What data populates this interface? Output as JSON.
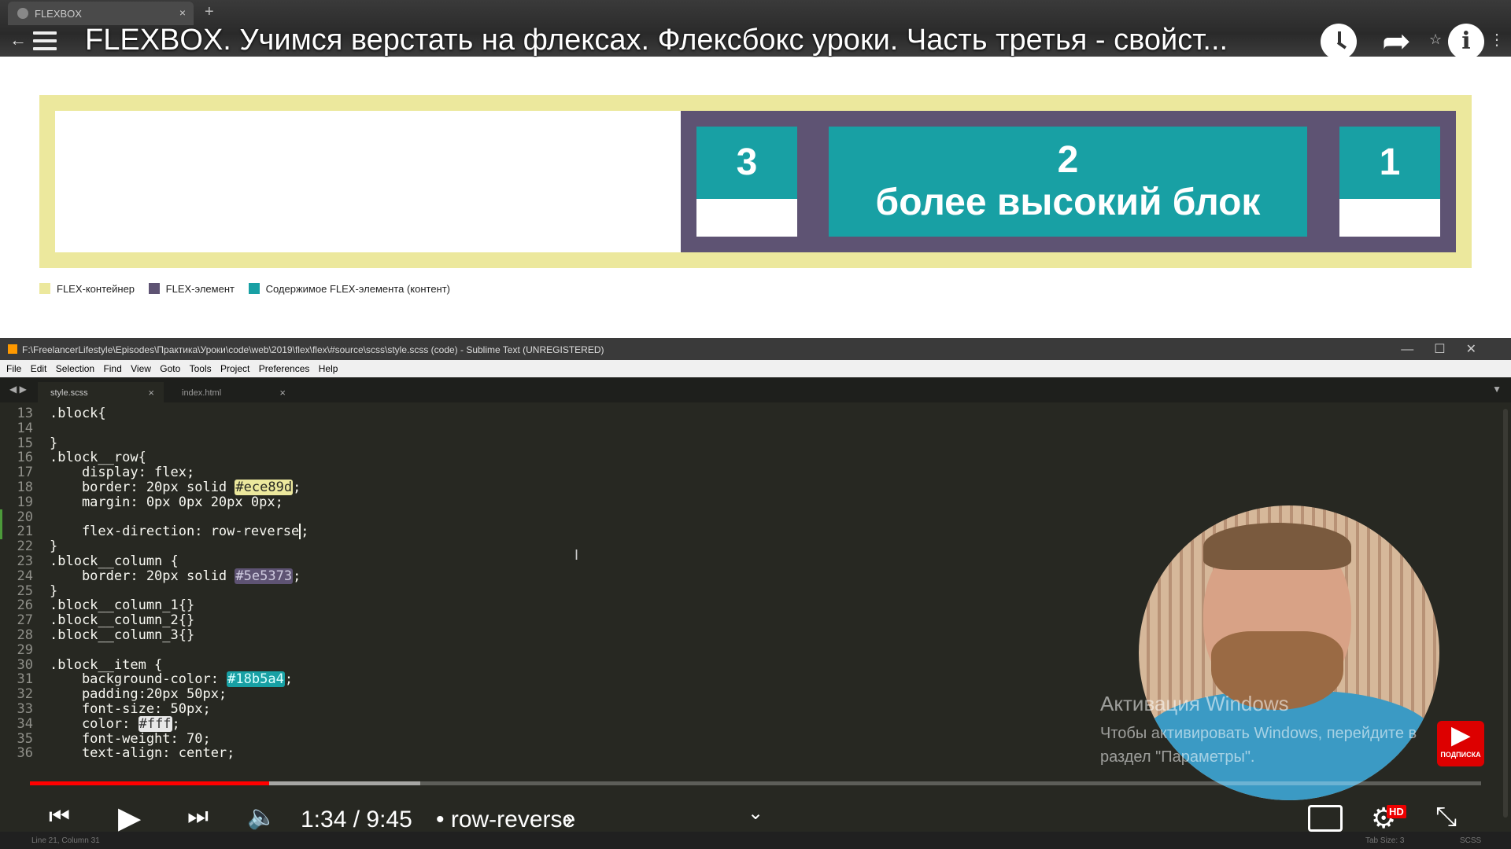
{
  "browser": {
    "tab_title": "FLEXBOX",
    "tab_close": "×",
    "new_tab": "+",
    "back": "←",
    "star": "☆",
    "menu_dots": "⋮"
  },
  "youtube_overlay": {
    "video_title": "FLEXBOX. Учимся верстать на флексах. Флексбокс уроки. Часть третья - свойст...",
    "share_glyph": "➦",
    "info_glyph": "i"
  },
  "demo": {
    "block_3": "3",
    "block_2_number": "2",
    "block_2_text": "более высокий блок",
    "block_1": "1",
    "colors": {
      "container": "#ece89d",
      "element": "#5e5373",
      "content": "#18a0a4"
    }
  },
  "legend": [
    {
      "label": "FLEX-контейнер",
      "color": "#ece89d"
    },
    {
      "label": "FLEX-элемент",
      "color": "#5e5373"
    },
    {
      "label": "Содержимое FLEX-элемента (контент)",
      "color": "#18a0a4"
    }
  ],
  "sublime": {
    "title": "F:\\FreelancerLifestyle\\Episodes\\Практика\\Уроки\\code\\web\\2019\\flex\\flex\\#source\\scss\\style.scss (code) - Sublime Text (UNREGISTERED)",
    "menu": [
      "File",
      "Edit",
      "Selection",
      "Find",
      "View",
      "Goto",
      "Tools",
      "Project",
      "Preferences",
      "Help"
    ],
    "tabs": [
      {
        "label": "style.scss",
        "close": "×"
      },
      {
        "label": "index.html",
        "close": "×"
      }
    ],
    "tab_nav": "◀ ▶",
    "tab_dropdown": "▼",
    "window_controls": "—☐✕",
    "code_lines": [
      {
        "n": "13",
        "t": ".block{"
      },
      {
        "n": "14",
        "t": "    "
      },
      {
        "n": "15",
        "t": "}"
      },
      {
        "n": "16",
        "t": ".block__row{"
      },
      {
        "n": "17",
        "t": "    display: flex;"
      },
      {
        "n": "18",
        "t": "    border: 20px solid #ece89d;"
      },
      {
        "n": "19",
        "t": "    margin: 0px 0px 20px 0px;"
      },
      {
        "n": "20",
        "t": "    "
      },
      {
        "n": "21",
        "t": "    flex-direction: row-reverse;"
      },
      {
        "n": "22",
        "t": "}"
      },
      {
        "n": "23",
        "t": ".block__column {"
      },
      {
        "n": "24",
        "t": "    border: 20px solid #5e5373;"
      },
      {
        "n": "25",
        "t": "}"
      },
      {
        "n": "26",
        "t": ".block__column_1{}"
      },
      {
        "n": "27",
        "t": ".block__column_2{}"
      },
      {
        "n": "28",
        "t": ".block__column_3{}"
      },
      {
        "n": "29",
        "t": ""
      },
      {
        "n": "30",
        "t": ".block__item {"
      },
      {
        "n": "31",
        "t": "    background-color: #18b5a4;"
      },
      {
        "n": "32",
        "t": "    padding:20px 50px;"
      },
      {
        "n": "33",
        "t": "    font-size: 50px;"
      },
      {
        "n": "34",
        "t": "    color: #fff;"
      },
      {
        "n": "35",
        "t": "    font-weight: 70;"
      },
      {
        "n": "36",
        "t": "    text-align: center;"
      }
    ],
    "status_left": "Line 21, Column 31",
    "status_tab": "Tab Size: 3",
    "status_syntax": "SCSS"
  },
  "watermark": {
    "line1": "Активация Windows",
    "line2": "Чтобы активировать Windows, перейдите в раздел \"Параметры\"."
  },
  "subscribe": {
    "label": "ПОДПИСКА",
    "glyph": "▶"
  },
  "player": {
    "time": "1:34 / 9:45",
    "chapter": "• row-reverse",
    "chapter_chevron": "›",
    "progress_fraction": 0.165,
    "buffer_fraction": 0.269,
    "hd_badge": "HD",
    "icons": {
      "prev": "⏮",
      "play": "▶",
      "next": "⏭",
      "volume": "🔈",
      "chevron": "⌄",
      "settings": "⚙",
      "fullscreen": "⤡"
    }
  }
}
